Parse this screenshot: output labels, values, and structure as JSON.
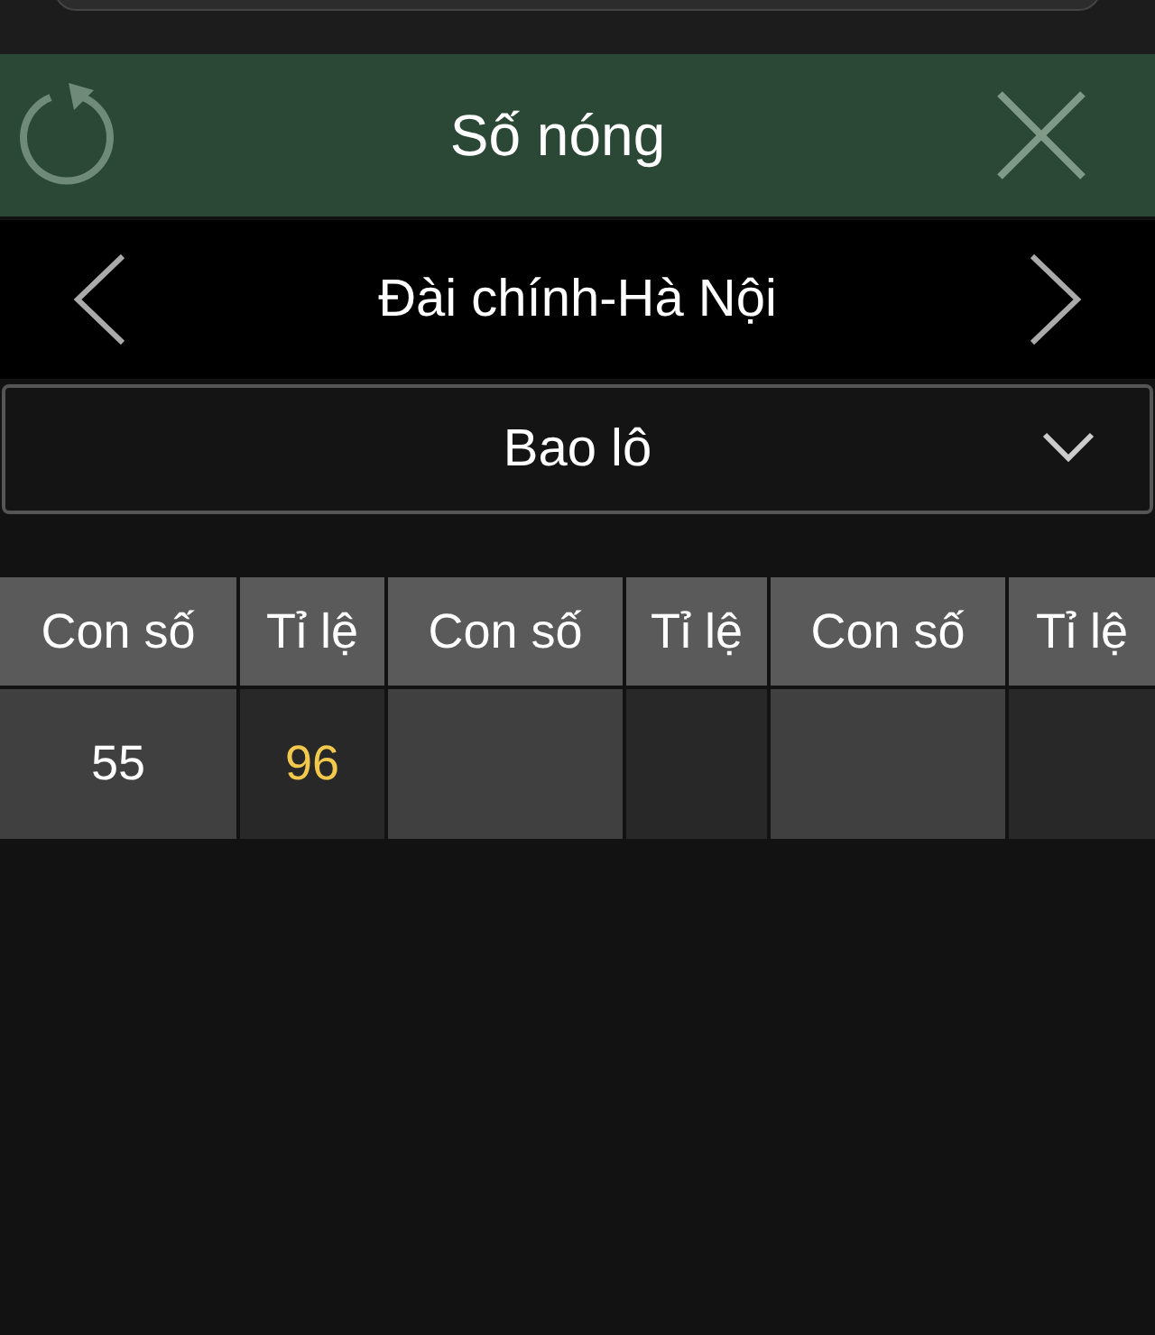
{
  "header": {
    "title": "Số nóng"
  },
  "station": {
    "name": "Đài chính-Hà Nội"
  },
  "dropdown": {
    "value": "Bao lô"
  },
  "table": {
    "columns": [
      "Con số",
      "Tỉ lệ",
      "Con số",
      "Tỉ lệ",
      "Con số",
      "Tỉ lệ"
    ],
    "rows": [
      [
        {
          "number": "55",
          "rate": "96"
        }
      ]
    ]
  }
}
